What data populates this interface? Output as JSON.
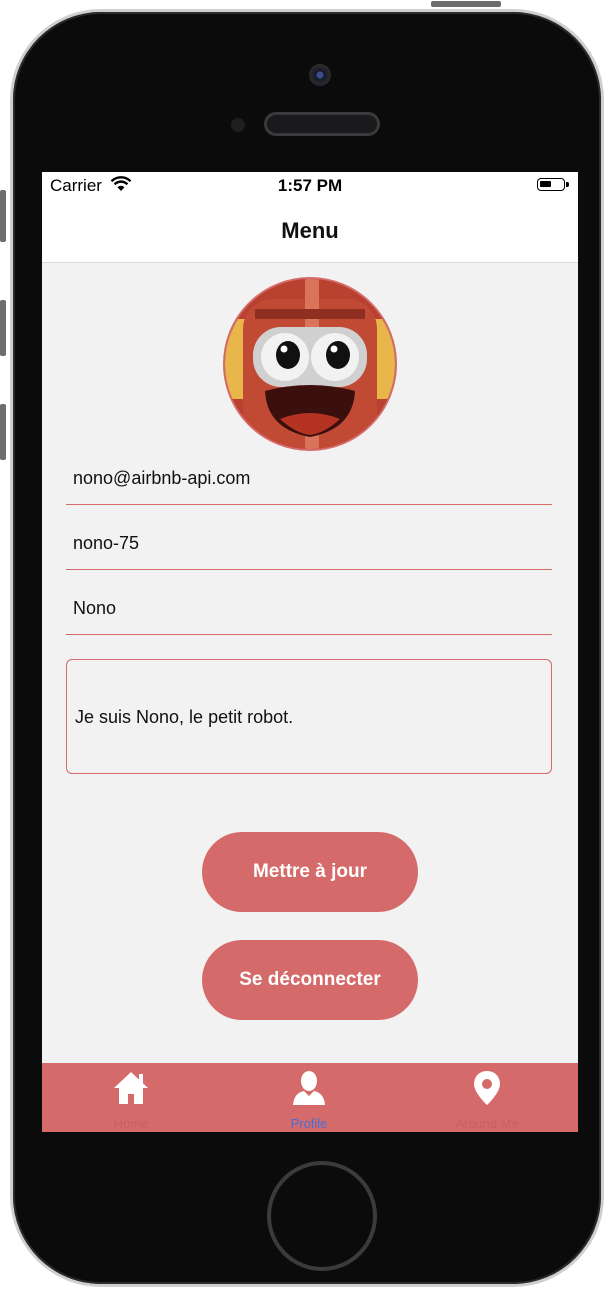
{
  "status_bar": {
    "carrier": "Carrier",
    "time": "1:57 PM"
  },
  "nav": {
    "title": "Menu"
  },
  "profile": {
    "email": "nono@airbnb-api.com",
    "username": "nono-75",
    "name": "Nono",
    "description": "Je suis Nono, le petit robot."
  },
  "buttons": {
    "update": "Mettre à jour",
    "logout": "Se déconnecter"
  },
  "tabs": [
    {
      "label": "Home",
      "icon": "home-icon",
      "active": false
    },
    {
      "label": "Profile",
      "icon": "person-icon",
      "active": true
    },
    {
      "label": "Around Me",
      "icon": "map-pin-icon",
      "active": false
    }
  ],
  "colors": {
    "accent": "#d46a6a",
    "active_tab": "#4a6fd4",
    "inactive_tab": "#c96060"
  }
}
